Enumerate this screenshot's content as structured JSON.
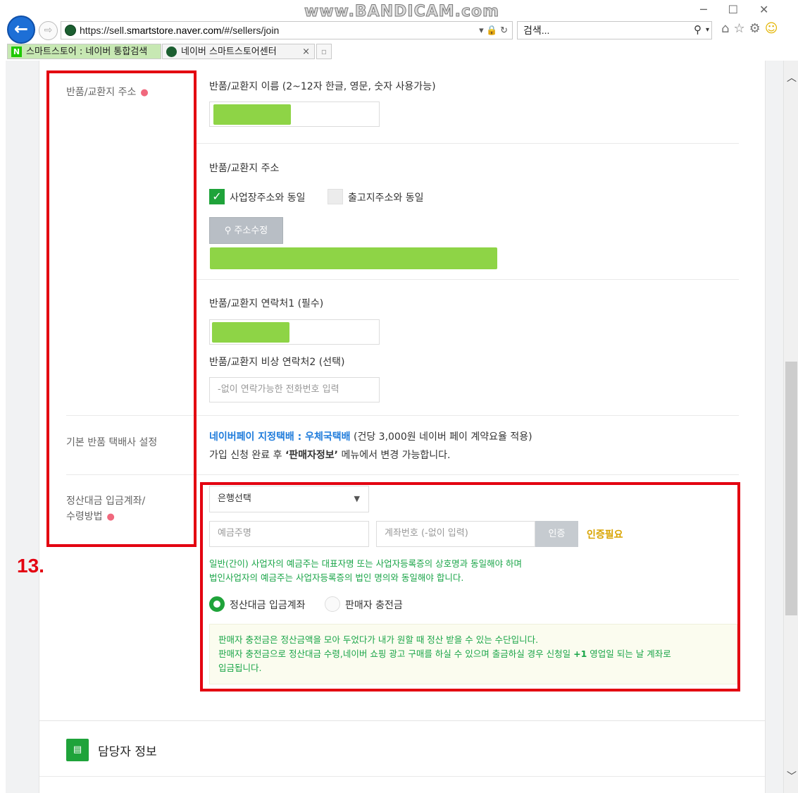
{
  "browser": {
    "watermark": "www.BANDICAM.com",
    "url_prefix": "https://sell.",
    "url_domain": "smartstore.naver.com",
    "url_path": "/#/sellers/join",
    "url_tools": "▾ 🔒 ↻",
    "search_placeholder": "검색...",
    "tabs": [
      {
        "label": "스마트스토어 : 네이버 통합검색",
        "icon": "N"
      },
      {
        "label": "네이버 스마트스토어센터",
        "icon": "●",
        "close": "×"
      }
    ],
    "toolbar_icons": [
      "home-icon",
      "star-icon",
      "gear-icon",
      "smiley-icon"
    ],
    "window_controls": [
      "minimize-icon",
      "maximize-icon",
      "close-icon"
    ]
  },
  "form": {
    "return_address_label": "반품/교환지 주소",
    "return_name_label": "반품/교환지 이름 (2~12자 한글, 영문, 숫자 사용가능)",
    "return_addr_sub": "반품/교환지 주소",
    "same_as_business": "사업장주소와 동일",
    "same_as_shipping": "출고지주소와 동일",
    "edit_address_btn": "주소수정",
    "contact1_label": "반품/교환지 연락처1 (필수)",
    "contact2_label": "반품/교환지 비상 연락처2 (선택)",
    "contact2_placeholder": "-없이 연락가능한 전화번호 입력",
    "default_courier_label": "기본 반품 택배사 설정",
    "naverpay_blue": "네이버페이 지정택배 : 우체국택배",
    "naverpay_rest": " (건당 3,000원 네이버 페이 계약요율 적용)",
    "notice_prefix": "가입 신청 완료 후 ",
    "notice_bold": "‘판매자정보’",
    "notice_suffix": " 메뉴에서 변경 가능합니다.",
    "settlement_label_line1": "정산대금 입금계좌/",
    "settlement_label_line2": "수령방법",
    "bank_select": "은행선택",
    "account_holder_placeholder": "예금주명",
    "account_number_placeholder": "계좌번호 (-없이 입력)",
    "verify_btn": "인증",
    "verify_needed": "인증필요",
    "holder_note1": "일반(간이) 사업자의 예금주는 대표자명 또는 사업자등록증의 상호명과 동일해야 하며",
    "holder_note2": "법인사업자의 예금주는 사업자등록증의 법인 명의와 동일해야 합니다.",
    "radio_settlement": "정산대금 입금계좌",
    "radio_charge": "판매자 충전금",
    "info_line1": "판매자 충전금은 정산금액을 모아 두었다가 내가 원할 때 정산 받을 수 있는 수단입니다.",
    "info_line2_a": "판매자 충전금으로 정산대금 수령,네이버 쇼핑 광고 구매를 하실 수 있으며 출금하실 경우 신청일 ",
    "info_line2_bold": "+1",
    "info_line2_b": " 영업일 되는 날 계좌로",
    "info_line3": "입금됩니다."
  },
  "annotation": {
    "step": "13."
  },
  "contact_section": {
    "title": "담당자 정보"
  },
  "colors": {
    "accent_green": "#1fa33a",
    "naver_blue": "#1e7bdb",
    "note_green": "#1aa548",
    "verify_yellow": "#d9a400",
    "annotation_red": "#e30010",
    "required_dot": "#f0687d"
  }
}
